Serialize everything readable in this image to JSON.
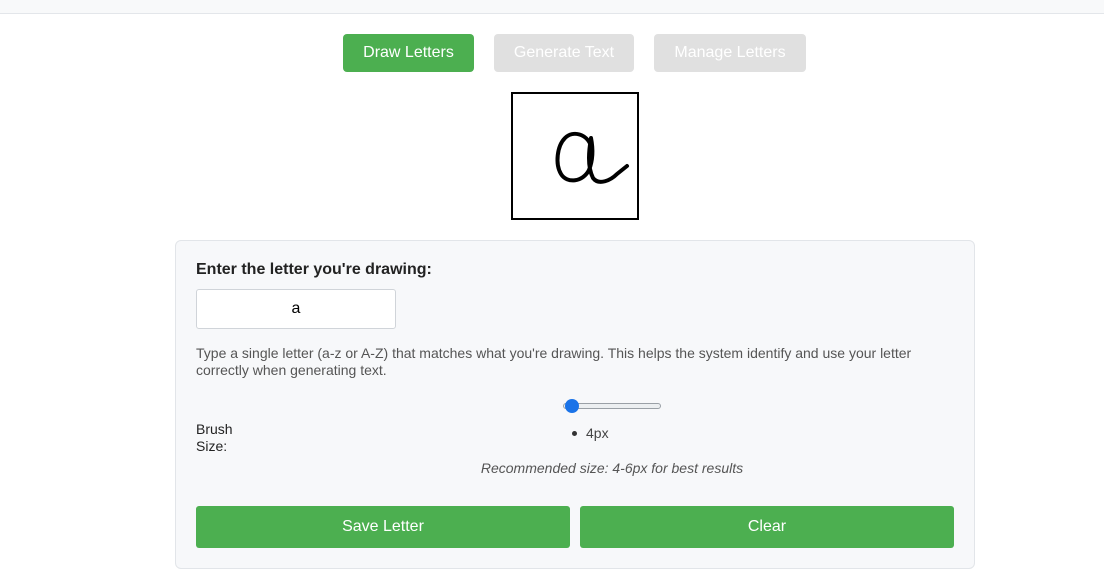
{
  "tabs": [
    {
      "label": "Draw Letters",
      "active": true
    },
    {
      "label": "Generate Text",
      "active": false
    },
    {
      "label": "Manage Letters",
      "active": false
    }
  ],
  "canvas": {
    "drawn_letter": "a"
  },
  "form": {
    "letter_label": "Enter the letter you're drawing:",
    "letter_value": "a",
    "help_text": "Type a single letter (a-z or A-Z) that matches what you're drawing. This helps the system identify and use your letter correctly when generating text.",
    "brush_label": "Brush Size:",
    "brush_value": 4,
    "brush_value_text": "4px",
    "recommend_text": "Recommended size: 4-6px for best results"
  },
  "buttons": {
    "save_label": "Save Letter",
    "clear_label": "Clear"
  },
  "colors": {
    "primary": "#4caf50",
    "inactive": "#e0e0e0",
    "slider_thumb": "#1a73e8"
  }
}
